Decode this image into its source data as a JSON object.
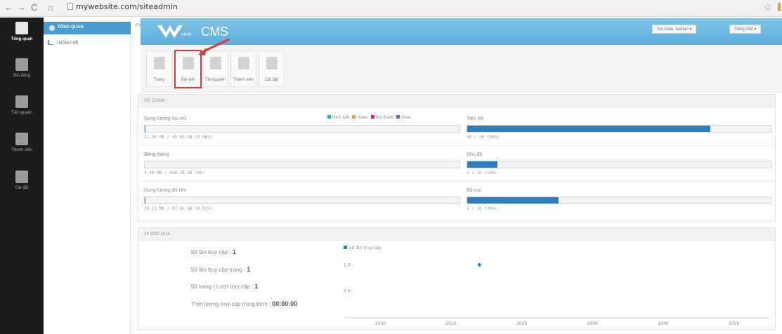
{
  "browser": {
    "url": "mywebsite.com/siteadmin"
  },
  "sidebar_dark": {
    "items": [
      {
        "label": "Tổng quan",
        "icon": "home-icon",
        "active": true
      },
      {
        "label": "Bài đăng",
        "icon": "document-icon"
      },
      {
        "label": "Tài nguyên",
        "icon": "media-icon"
      },
      {
        "label": "Thành viên",
        "icon": "members-icon"
      },
      {
        "label": "Cài đặt",
        "icon": "wrench-icon"
      }
    ]
  },
  "sidebar_sub": {
    "active": "TỔNG QUAN",
    "item": "THỐNG KÊ"
  },
  "header": {
    "logo": "CMS",
    "logo_small": "vnvn",
    "greeting": "Xin chào, loohan ▾",
    "language": "Tiếng Việt ▾"
  },
  "toolbar": {
    "buttons": [
      {
        "label": "Trang"
      },
      {
        "label": "Bài viết",
        "highlight": true
      },
      {
        "label": "Tài nguyên"
      },
      {
        "label": "Thành viên"
      },
      {
        "label": "Cài đặt"
      }
    ]
  },
  "usage": {
    "title": "SỬ DỤNG",
    "legend": [
      {
        "label": "Hình ảnh",
        "color": "#3aa3c8"
      },
      {
        "label": "Video",
        "color": "#e8a13a"
      },
      {
        "label": "Âm thanh",
        "color": "#c0307a"
      },
      {
        "label": "Khác",
        "color": "#7a56c0"
      }
    ],
    "left": [
      {
        "label": "Dung lượng lưu trữ",
        "value": "32.25 MB / 48.83 GB (0.06%)",
        "fraction": 0.0006
      },
      {
        "label": "Băng thông",
        "value": "3.49 MB / 488.28 GB (0%)",
        "fraction": 0.0
      },
      {
        "label": "Dung lượng dữ liệu",
        "value": "20.11 MB / 97.66 GB (0.02%)",
        "fraction": 0.0002
      }
    ],
    "right": [
      {
        "label": "Tiện ích",
        "value": "40 / 50 (80%)",
        "fraction": 0.8
      },
      {
        "label": "Chủ đề",
        "value": "1 / 10 (10%)",
        "fraction": 0.1
      },
      {
        "label": "Bố cục",
        "value": "3 / 10 (30%)",
        "fraction": 0.3
      }
    ]
  },
  "stats": {
    "title": "24 GIỜ QUA",
    "items": [
      {
        "label": "Số lần truy cập :",
        "value": "1"
      },
      {
        "label": "Số lần truy cập trang :",
        "value": "1"
      },
      {
        "label": "Số trang / Lượt truy cập :",
        "value": "1"
      },
      {
        "label": "Thời lượng truy cập trung bình :",
        "value": "00:00:00"
      }
    ]
  },
  "chart_data": {
    "type": "scatter",
    "series": [
      {
        "name": "Số lần truy cập",
        "color": "#2a7fc0",
        "points": [
          {
            "x": 2014,
            "y": 1.0
          }
        ]
      }
    ],
    "x_ticks": [
      "2000",
      "2010",
      "2020",
      "2030",
      "2040",
      "2050"
    ],
    "y_ticks": [
      "0.5",
      "1.0"
    ],
    "xlim": [
      1995,
      2055
    ],
    "ylim": [
      0,
      1.1
    ],
    "grid": false,
    "legend_position": "top-left"
  }
}
